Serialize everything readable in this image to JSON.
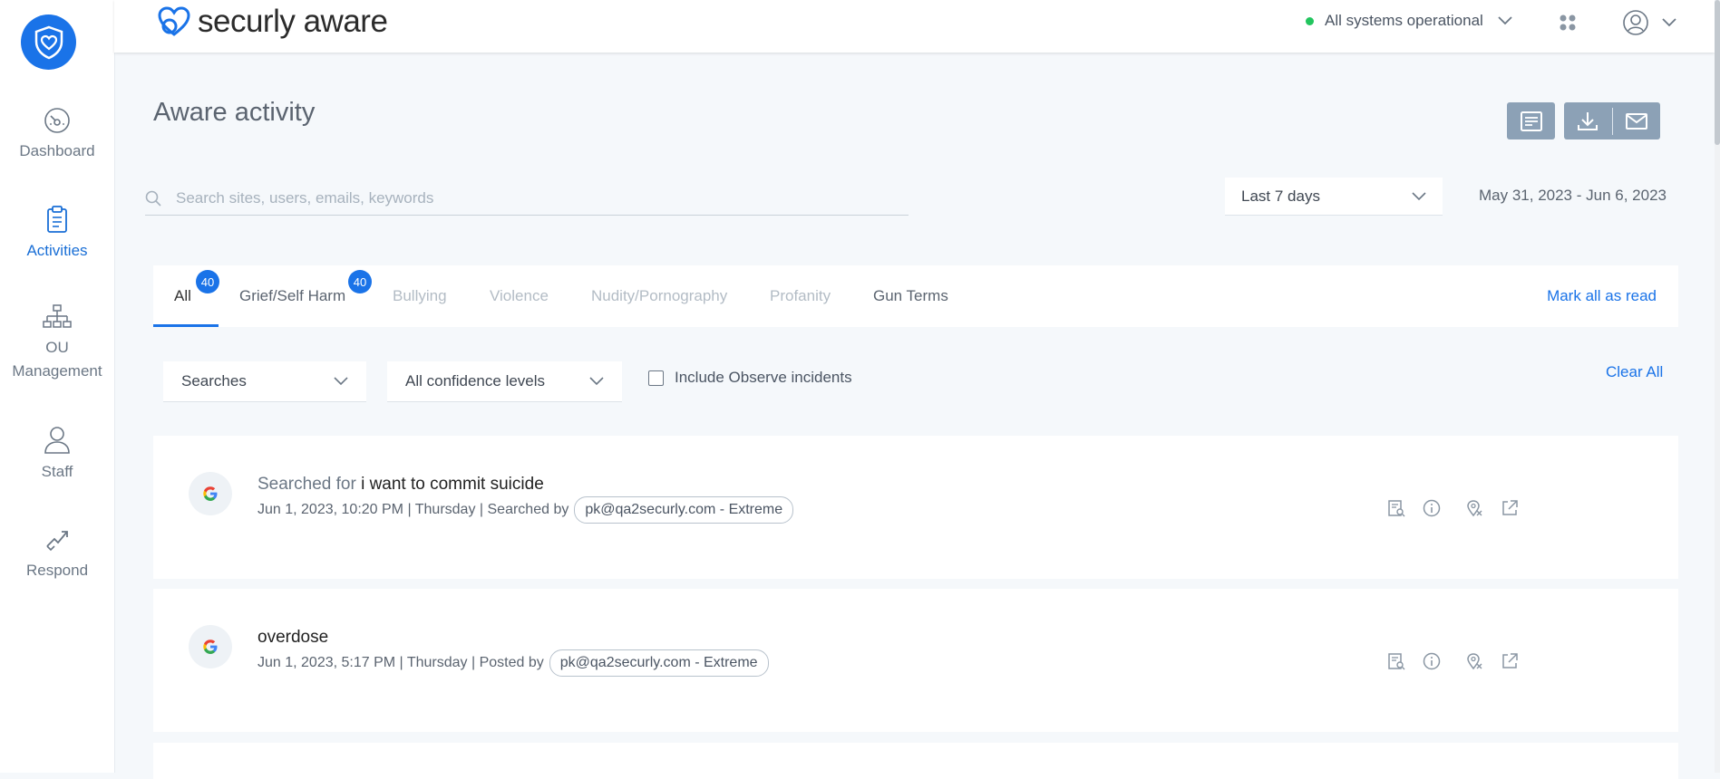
{
  "sidebar": {
    "items": [
      {
        "label": "Dashboard",
        "icon": "gauge-icon"
      },
      {
        "label": "Activities",
        "icon": "clipboard-icon",
        "active": true
      },
      {
        "label": "OU Management",
        "line1": "OU",
        "line2": "Management",
        "icon": "org-chart-icon"
      },
      {
        "label": "Staff",
        "icon": "person-icon"
      },
      {
        "label": "Respond",
        "icon": "respond-icon"
      }
    ]
  },
  "header": {
    "brand": "securly aware",
    "status": "All systems operational",
    "status_color": "#22c55e"
  },
  "page": {
    "title": "Aware activity"
  },
  "search": {
    "placeholder": "Search sites, users, emails, keywords"
  },
  "date_filter": {
    "selected": "Last 7 days",
    "range": "May 31, 2023 -  Jun 6, 2023"
  },
  "tabs": [
    {
      "label": "All",
      "badge": "40",
      "active": true
    },
    {
      "label": "Grief/Self Harm",
      "badge": "40"
    },
    {
      "label": "Bullying"
    },
    {
      "label": "Violence"
    },
    {
      "label": "Nudity/Pornography"
    },
    {
      "label": "Profanity"
    },
    {
      "label": "Gun Terms"
    }
  ],
  "mark_all_read": "Mark all as read",
  "filters": {
    "type": "Searches",
    "confidence": "All confidence levels",
    "observe_label": "Include Observe incidents",
    "clear_all": "Clear All"
  },
  "activities": [
    {
      "prefix": "Searched for",
      "term": "i want to commit suicide",
      "meta": "Jun 1, 2023, 10:20 PM | Thursday | Searched by",
      "user": "pk@qa2securly.com - Extreme"
    },
    {
      "prefix": "",
      "term": "overdose",
      "meta": "Jun 1, 2023, 5:17 PM | Thursday | Posted by",
      "user": "pk@qa2securly.com - Extreme"
    }
  ],
  "colors": {
    "accent": "#1a73e8",
    "button_gray": "#8ca1b6"
  }
}
